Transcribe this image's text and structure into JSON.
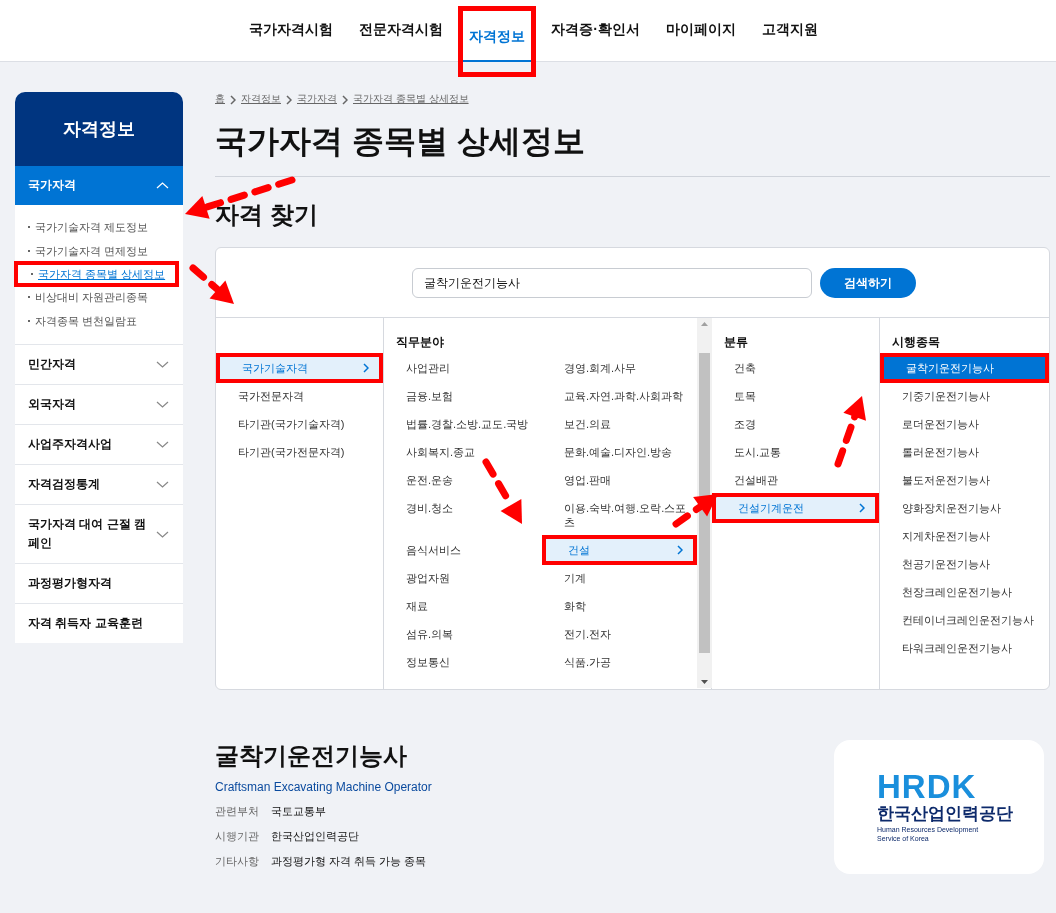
{
  "nav": [
    {
      "label": "국가자격시험",
      "selected": false,
      "highlighted": false
    },
    {
      "label": "전문자격시험",
      "selected": false,
      "highlighted": false
    },
    {
      "label": "자격정보",
      "selected": true,
      "highlighted": true
    },
    {
      "label": "자격증·확인서",
      "selected": false,
      "highlighted": false
    },
    {
      "label": "마이페이지",
      "selected": false,
      "highlighted": false
    },
    {
      "label": "고객지원",
      "selected": false,
      "highlighted": false
    }
  ],
  "sidebar": {
    "title": "자격정보",
    "sections": [
      {
        "label": "국가자격",
        "kind": "accordion",
        "expanded": true,
        "children": [
          {
            "label": "국가기술자격 제도정보",
            "selected": false,
            "highlighted": false
          },
          {
            "label": "국가기술자격 면제정보",
            "selected": false,
            "highlighted": false
          },
          {
            "label": "국가자격 종목별 상세정보",
            "selected": true,
            "highlighted": true
          },
          {
            "label": "비상대비 자원관리종목",
            "selected": false,
            "highlighted": false
          },
          {
            "label": "자격종목 변천일람표",
            "selected": false,
            "highlighted": false
          }
        ]
      },
      {
        "label": "민간자격",
        "kind": "accordion",
        "expanded": false
      },
      {
        "label": "외국자격",
        "kind": "accordion",
        "expanded": false
      },
      {
        "label": "사업주자격사업",
        "kind": "accordion",
        "expanded": false
      },
      {
        "label": "자격검정통계",
        "kind": "accordion",
        "expanded": false
      },
      {
        "label": "국가자격 대여 근절 캠페인",
        "kind": "accordion",
        "expanded": false
      },
      {
        "label": "과정평가형자격",
        "kind": "link"
      },
      {
        "label": "자격 취득자 교육훈련",
        "kind": "link"
      }
    ]
  },
  "breadcrumb": [
    "홈",
    "자격정보",
    "국가자격",
    "국가자격 종목별 상세정보"
  ],
  "title": "국가자격 종목별 상세정보",
  "section_title": "자격 찾기",
  "search": {
    "value": "굴착기운전기능사",
    "button": "검색하기"
  },
  "columns": [
    {
      "kind": "group",
      "items": [
        {
          "label": "국가기술자격",
          "selected": true,
          "highlighted": true
        },
        {
          "label": "국가전문자격",
          "selected": false,
          "highlighted": false
        },
        {
          "label": "타기관(국가기술자격)",
          "selected": false,
          "highlighted": false
        },
        {
          "label": "타기관(국가전문자격)",
          "selected": false,
          "highlighted": false
        }
      ]
    },
    {
      "kind": "pairs",
      "heading": "직무분야",
      "items": [
        {
          "label": "사업관리",
          "selected": false,
          "highlighted": false
        },
        {
          "label": "경영.회계.사무",
          "selected": false,
          "highlighted": false
        },
        {
          "label": "금융.보험",
          "selected": false,
          "highlighted": false
        },
        {
          "label": "교육.자연.과학.사회과학",
          "selected": false,
          "highlighted": false
        },
        {
          "label": "법률.경찰.소방.교도.국방",
          "selected": false,
          "highlighted": false
        },
        {
          "label": "보건.의료",
          "selected": false,
          "highlighted": false
        },
        {
          "label": "사회복지.종교",
          "selected": false,
          "highlighted": false
        },
        {
          "label": "문화.예술.디자인.방송",
          "selected": false,
          "highlighted": false
        },
        {
          "label": "운전.운송",
          "selected": false,
          "highlighted": false
        },
        {
          "label": "영업.판매",
          "selected": false,
          "highlighted": false
        },
        {
          "label": "경비.청소",
          "selected": false,
          "highlighted": false
        },
        {
          "label": "이용.숙박.여행.오락.스포츠",
          "selected": false,
          "highlighted": false
        },
        {
          "label": "음식서비스",
          "selected": false,
          "highlighted": false
        },
        {
          "label": "건설",
          "selected": true,
          "highlighted": true
        },
        {
          "label": "광업자원",
          "selected": false,
          "highlighted": false
        },
        {
          "label": "기계",
          "selected": false,
          "highlighted": false
        },
        {
          "label": "재료",
          "selected": false,
          "highlighted": false
        },
        {
          "label": "화학",
          "selected": false,
          "highlighted": false
        },
        {
          "label": "섬유.의복",
          "selected": false,
          "highlighted": false
        },
        {
          "label": "전기.전자",
          "selected": false,
          "highlighted": false
        },
        {
          "label": "정보통신",
          "selected": false,
          "highlighted": false
        },
        {
          "label": "식품.가공",
          "selected": false,
          "highlighted": false
        }
      ]
    },
    {
      "kind": "group",
      "heading": "분류",
      "items": [
        {
          "label": "건축",
          "selected": false,
          "highlighted": false
        },
        {
          "label": "토목",
          "selected": false,
          "highlighted": false
        },
        {
          "label": "조경",
          "selected": false,
          "highlighted": false
        },
        {
          "label": "도시.교통",
          "selected": false,
          "highlighted": false
        },
        {
          "label": "건설배관",
          "selected": false,
          "highlighted": false
        },
        {
          "label": "건설기계운전",
          "selected": true,
          "highlighted": true
        }
      ]
    },
    {
      "kind": "final",
      "heading": "시행종목",
      "items": [
        {
          "label": "굴착기운전기능사",
          "selected": true,
          "highlighted": true
        },
        {
          "label": "기중기운전기능사",
          "selected": false,
          "highlighted": false
        },
        {
          "label": "로더운전기능사",
          "selected": false,
          "highlighted": false
        },
        {
          "label": "롤러운전기능사",
          "selected": false,
          "highlighted": false
        },
        {
          "label": "불도저운전기능사",
          "selected": false,
          "highlighted": false
        },
        {
          "label": "양화장치운전기능사",
          "selected": false,
          "highlighted": false
        },
        {
          "label": "지게차운전기능사",
          "selected": false,
          "highlighted": false
        },
        {
          "label": "천공기운전기능사",
          "selected": false,
          "highlighted": false
        },
        {
          "label": "천장크레인운전기능사",
          "selected": false,
          "highlighted": false
        },
        {
          "label": "컨테이너크레인운전기능사",
          "selected": false,
          "highlighted": false
        },
        {
          "label": "타워크레인운전기능사",
          "selected": false,
          "highlighted": false
        }
      ]
    }
  ],
  "detail": {
    "title": "굴착기운전기능사",
    "subtitle": "Craftsman Excavating Machine Operator",
    "rows": [
      {
        "label": "관련부처",
        "value": "국토교통부"
      },
      {
        "label": "시행기관",
        "value": "한국산업인력공단"
      },
      {
        "label": "기타사항",
        "value": "과정평가형 자격 취득 가능 종목"
      }
    ]
  },
  "logo": {
    "mark": "HRDK",
    "name": "한국산업인력공단",
    "caption": "Human Resources Development Service of Korea"
  },
  "annotations": {
    "arrows": true
  }
}
